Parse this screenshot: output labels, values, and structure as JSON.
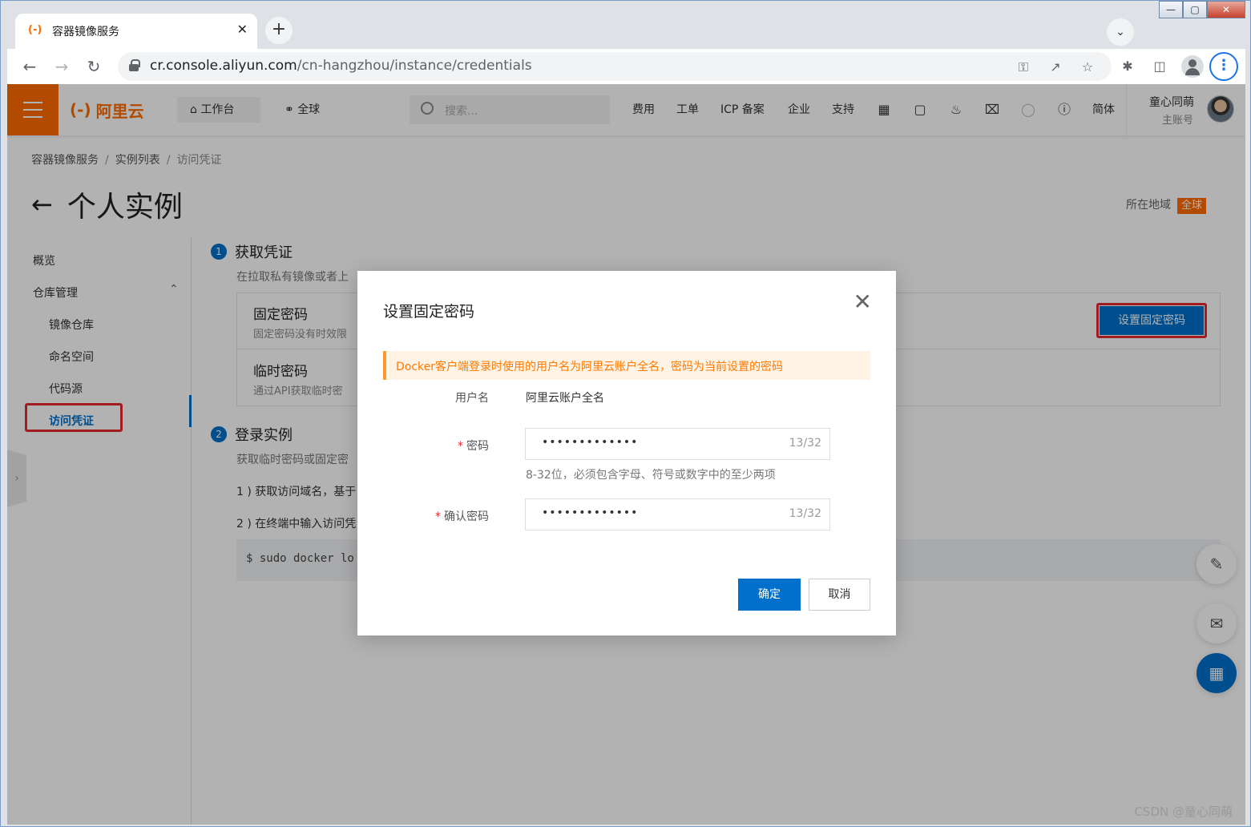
{
  "browser": {
    "tab_title": "容器镜像服务",
    "favicon": "(-)",
    "tab_close": "✕",
    "new_tab": "+",
    "url_domain": "cr.console.aliyun.com",
    "url_path": "/cn-hangzhou/instance/credentials",
    "window_controls": {
      "minimize": "—",
      "maximize": "▢",
      "close": "✕"
    }
  },
  "header": {
    "logo_mark": "(-)",
    "logo_text": "阿里云",
    "workbench": "工作台",
    "global": "全球",
    "search_placeholder": "搜索...",
    "links": [
      "费用",
      "工单",
      "ICP 备案",
      "企业",
      "支持"
    ],
    "lang": "简体",
    "user_name": "童心同萌",
    "user_role": "主账号"
  },
  "breadcrumb": {
    "item1": "容器镜像服务",
    "item2": "实例列表",
    "item3": "访问凭证"
  },
  "page": {
    "title": "个人实例",
    "region_label": "所在地域",
    "region_value": "全球"
  },
  "sidebar": {
    "overview": "概览",
    "repo_mgmt": "仓库管理",
    "image_repo": "镜像仓库",
    "namespace": "命名空间",
    "code_source": "代码源",
    "credentials": "访问凭证"
  },
  "main": {
    "step1_num": "1",
    "step1_title": "获取凭证",
    "step1_desc": "在拉取私有镜像或者上",
    "fixed_pwd_title": "固定密码",
    "fixed_pwd_desc": "固定密码没有时效限",
    "temp_pwd_title": "临时密码",
    "temp_pwd_desc": "通过API获取临时密",
    "set_fixed_btn": "设置固定密码",
    "step2_num": "2",
    "step2_title": "登录实例",
    "step2_desc": "获取临时密码或固定密",
    "step2_item1": "1 ) 获取访问域名，基于",
    "step2_item2": "2 ) 在终端中输入访问凭",
    "code": "$ sudo docker lo"
  },
  "modal": {
    "title": "设置固定密码",
    "close": "✕",
    "notice": "Docker客户端登录时使用的用户名为阿里云账户全名，密码为当前设置的密码",
    "username_label": "用户名",
    "username_value": "阿里云账户全名",
    "required_mark": "*",
    "password_label": "密码",
    "password_value": "•••••••••••••",
    "password_count": "13/32",
    "password_hint": "8-32位，必须包含字母、符号或数字中的至少两项",
    "confirm_label": "确认密码",
    "confirm_value": "•••••••••••••",
    "confirm_count": "13/32",
    "ok": "确定",
    "cancel": "取消"
  },
  "watermark": "CSDN @童心同萌",
  "colors": {
    "brand": "#ff6a00",
    "primary": "#0070cc",
    "highlight": "#e8282c"
  }
}
